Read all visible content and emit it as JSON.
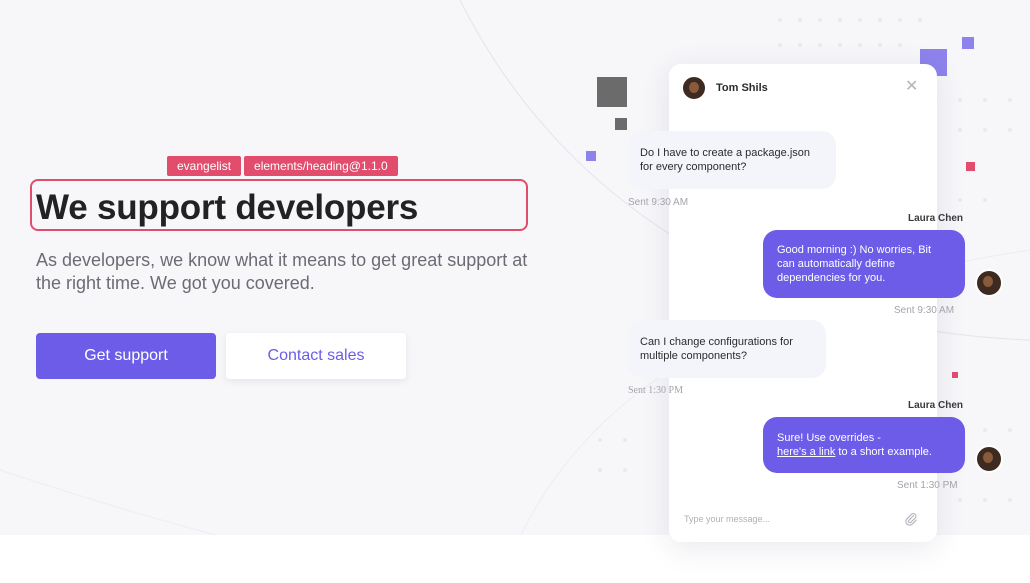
{
  "hero": {
    "tags": [
      "evangelist",
      "elements/heading@1.1.0"
    ],
    "heading": "We support developers",
    "subtext": "As developers, we know what it means to get great support at the right time. We got you covered.",
    "primary_button": "Get support",
    "secondary_button": "Contact sales"
  },
  "chat": {
    "header_name": "Tom Shils",
    "messages": [
      {
        "direction": "in",
        "text_lines": [
          "Do I have to create a package.json",
          "for every component?"
        ],
        "time": "Sent 9:30 AM"
      },
      {
        "direction": "out",
        "sender": "Laura Chen",
        "text_lines": [
          "Good morning :) No worries, Bit",
          "can automatically define",
          "dependencies for you."
        ],
        "time": "Sent 9:30 AM"
      },
      {
        "direction": "in",
        "text_lines": [
          "Can I change configurations for",
          "multiple components?"
        ],
        "time": "Sent 1:30 PM"
      },
      {
        "direction": "out",
        "sender": "Laura Chen",
        "text_line1": "Sure! Use overrides -",
        "link_text": "here's a link",
        "text_after_link": " to a short example.",
        "time": "Sent 1:30 PM"
      }
    ],
    "input_placeholder": "Type your message..."
  },
  "colors": {
    "accent": "#6c5ce7",
    "tag": "#e24d6d",
    "decor_gray": "#6b6b6b"
  }
}
